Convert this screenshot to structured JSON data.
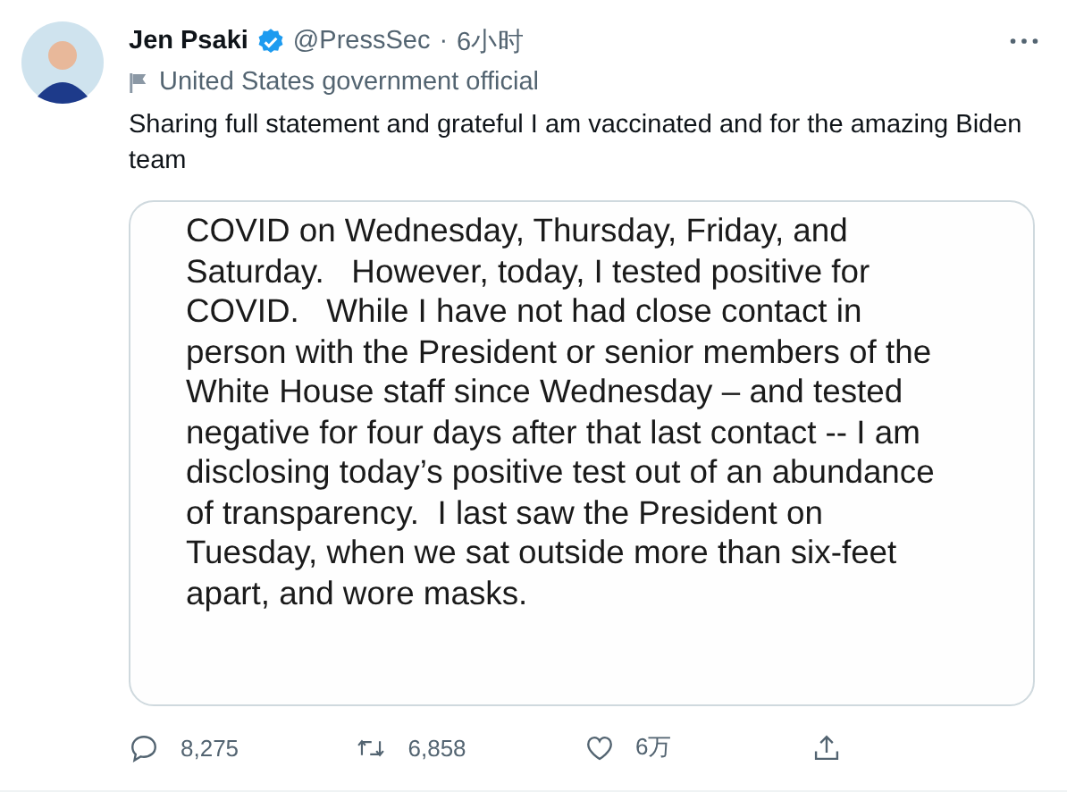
{
  "author": {
    "name": "Jen Psaki",
    "verified": true,
    "handle": "@PressSec",
    "separator": "·",
    "time": "6小时"
  },
  "label": "United States government official",
  "text": "Sharing full statement and grateful I am vaccinated and for the amazing Biden team",
  "image_lines": [
    "COVID on Wednesday, Thursday, Friday, and",
    "Saturday.   However, today, I tested positive for",
    "COVID.   While I have not had close contact in",
    "person with the President or senior members of the",
    "White House staff since Wednesday – and tested",
    "negative for four days after that last contact -- I am",
    "disclosing today’s positive test out of an abundance",
    "of transparency.  I last saw the President on",
    "Tuesday, when we sat outside more than six-feet",
    "apart, and wore masks."
  ],
  "actions": [
    {
      "kind": "reply",
      "count": "8,275"
    },
    {
      "kind": "retweet",
      "count": "6,858"
    },
    {
      "kind": "like",
      "count": "6万"
    },
    {
      "kind": "share"
    }
  ]
}
